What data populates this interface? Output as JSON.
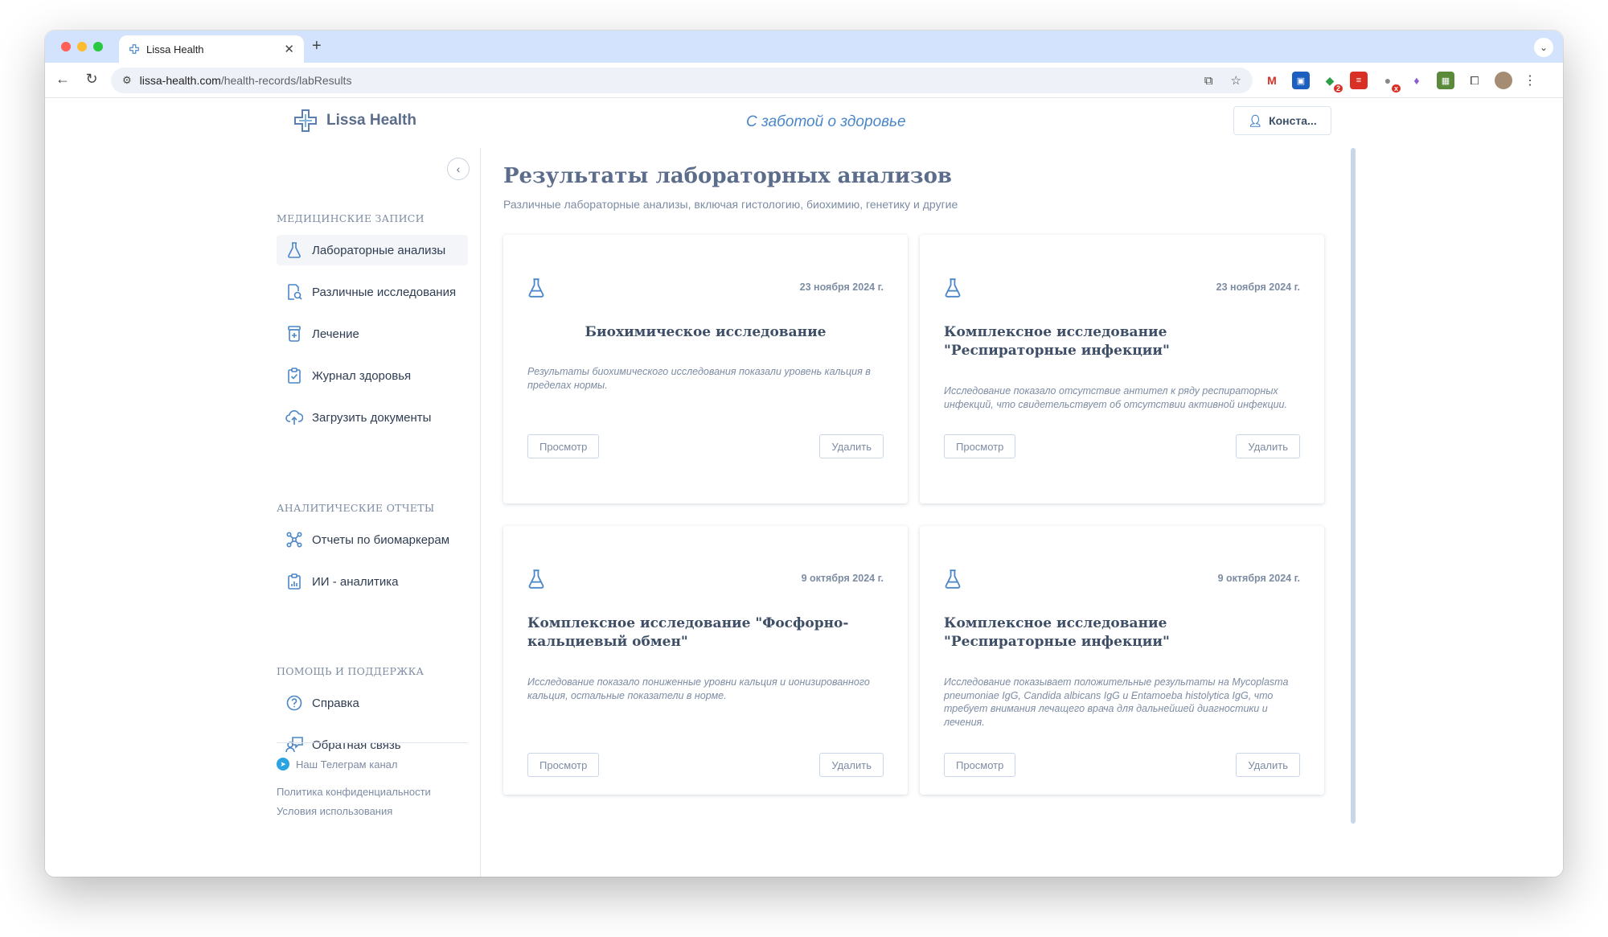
{
  "browser": {
    "tab_title": "Lissa Health",
    "url_host": "lissa-health.com",
    "url_path": "/health-records/labResults"
  },
  "header": {
    "logo_text": "Lissa Health",
    "tagline": "С заботой о здоровье",
    "user_button": "Конста..."
  },
  "sidebar": {
    "section_records": "МЕДИЦИНСКИЕ ЗАПИСИ",
    "records_items": [
      {
        "label": "Лабораторные анализы",
        "icon": "flask-icon"
      },
      {
        "label": "Различные исследования",
        "icon": "document-search-icon"
      },
      {
        "label": "Лечение",
        "icon": "pill-bottle-icon"
      },
      {
        "label": "Журнал здоровья",
        "icon": "clipboard-check-icon"
      },
      {
        "label": "Загрузить документы",
        "icon": "cloud-upload-icon"
      }
    ],
    "section_analytics": "АНАЛИТИЧЕСКИЕ ОТЧЕТЫ",
    "analytics_items": [
      {
        "label": "Отчеты по биомаркерам",
        "icon": "network-icon"
      },
      {
        "label": "ИИ - аналитика",
        "icon": "clipboard-chart-icon"
      }
    ],
    "section_help": "ПОМОЩЬ И ПОДДЕРЖКА",
    "help_items": [
      {
        "label": "Справка",
        "icon": "question-icon"
      },
      {
        "label": "Обратная связь",
        "icon": "feedback-icon"
      }
    ],
    "footer": {
      "telegram": "Наш Телеграм канал",
      "privacy": "Политика конфиденциальности",
      "terms": "Условия использования"
    }
  },
  "main": {
    "title": "Результаты лабораторных анализов",
    "subtitle": "Различные лабораторные анализы, включая гистологию, биохимию, генетику и другие",
    "view_label": "Просмотр",
    "delete_label": "Удалить",
    "cards": [
      {
        "date": "23 ноября 2024 г.",
        "title": "Биохимическое исследование",
        "description": "Результаты биохимического исследования показали уровень кальция в пределах нормы."
      },
      {
        "date": "23 ноября 2024 г.",
        "title": "Комплексное исследование \"Респираторные инфекции\"",
        "description": "Исследование показало отсутствие антител к ряду респираторных инфекций, что свидетельствует об отсутствии активной инфекции."
      },
      {
        "date": "9 октября 2024 г.",
        "title": "Комплексное исследование \"Фосфорно-кальциевый обмен\"",
        "description": "Исследование показало пониженные уровни кальция и ионизированного кальция, остальные показатели в норме."
      },
      {
        "date": "9 октября 2024 г.",
        "title": "Комплексное исследование \"Респираторные инфекции\"",
        "description": "Исследование показывает положительные результаты на Mycoplasma pneumoniae IgG, Candida albicans IgG и Entamoeba histolytica IgG, что требует внимания лечащего врача для дальнейшей диагностики и лечения."
      }
    ]
  },
  "colors": {
    "accent": "#4a86c8",
    "title": "#5b6d8a",
    "muted": "#7d8ca3",
    "tabbar": "#d3e3fd"
  }
}
